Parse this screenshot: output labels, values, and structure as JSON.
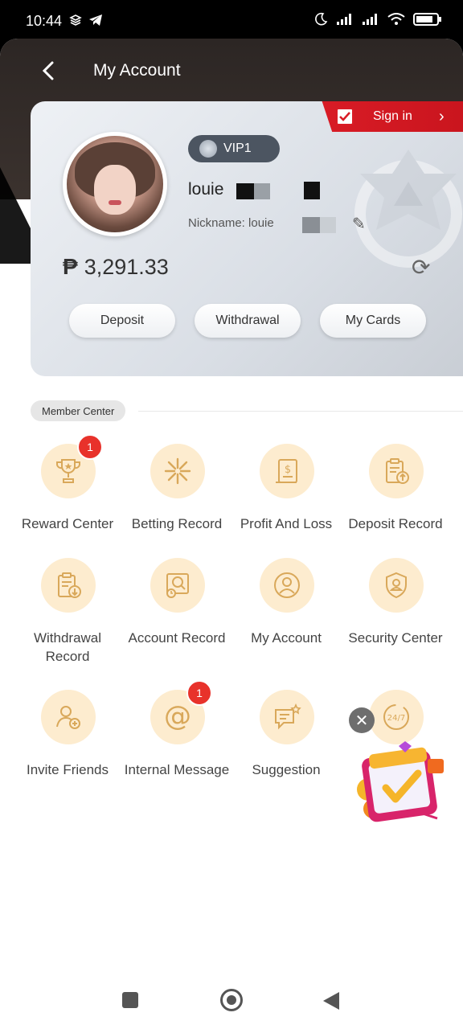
{
  "status_bar": {
    "time": "10:44"
  },
  "header": {
    "title": "My Account"
  },
  "account_card": {
    "signin_label": "Sign in",
    "vip_level": "VIP1",
    "username": "louie",
    "nickname": "Nickname: louie",
    "balance": "3,291.33",
    "currency_symbol": "₱",
    "actions": [
      "Deposit",
      "Withdrawal",
      "My Cards"
    ]
  },
  "member_center": {
    "section_label": "Member Center",
    "items": [
      {
        "label": "Reward Center",
        "icon": "trophy-icon",
        "badge": "1"
      },
      {
        "label": "Betting Record",
        "icon": "star-burst-icon",
        "badge": ""
      },
      {
        "label": "Profit And Loss",
        "icon": "dollar-document-icon",
        "badge": ""
      },
      {
        "label": "Deposit Record",
        "icon": "clipboard-upload-icon",
        "badge": ""
      },
      {
        "label": "Withdrawal Record",
        "icon": "clipboard-download-icon",
        "badge": ""
      },
      {
        "label": "Account Record",
        "icon": "account-record-icon",
        "badge": ""
      },
      {
        "label": "My Account",
        "icon": "user-icon",
        "badge": ""
      },
      {
        "label": "Security Center",
        "icon": "shield-user-icon",
        "badge": ""
      },
      {
        "label": "Invite Friends",
        "icon": "add-user-icon",
        "badge": ""
      },
      {
        "label": "Internal Message",
        "icon": "at-icon",
        "badge": "1"
      },
      {
        "label": "Suggestion",
        "icon": "chat-star-icon",
        "badge": ""
      },
      {
        "label": "",
        "icon": "24-7-support-icon",
        "badge": ""
      }
    ]
  },
  "colors": {
    "accent": "#d91c26",
    "icon_bg": "#fdeccf",
    "icon_fg": "#d9a85a",
    "badge": "#e8322b"
  }
}
